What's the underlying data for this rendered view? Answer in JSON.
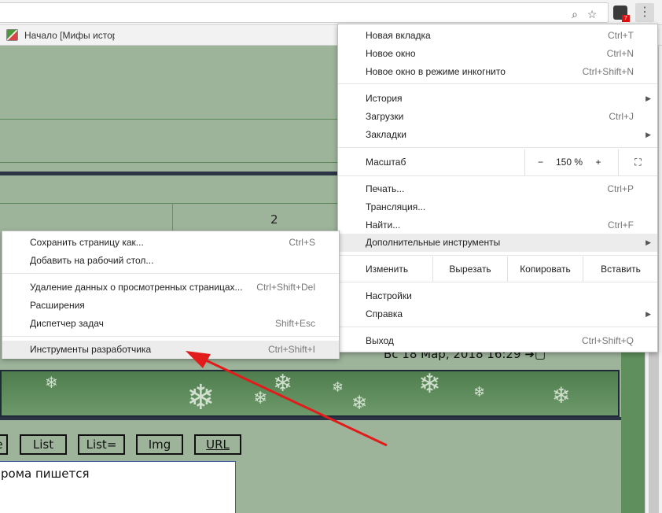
{
  "browser": {
    "bookmark_label": "Начало [Мифы истор",
    "icons": [
      "zoom-icon",
      "star-icon",
      "extension-icon",
      "menu-dots-icon"
    ],
    "extension_badge": "7"
  },
  "page": {
    "pagination_number": "2",
    "date_text": "Вс 18 Мар, 2018 16:29",
    "tag_buttons": [
      "e",
      "List",
      "List=",
      "Img",
      "URL"
    ],
    "textarea_value": "рома пишется"
  },
  "chrome_menu": {
    "new_tab": {
      "label": "Новая вкладка",
      "shortcut": "Ctrl+T"
    },
    "new_window": {
      "label": "Новое окно",
      "shortcut": "Ctrl+N"
    },
    "incognito": {
      "label": "Новое окно в режиме инкогнито",
      "shortcut": "Ctrl+Shift+N"
    },
    "history": {
      "label": "История"
    },
    "downloads": {
      "label": "Загрузки",
      "shortcut": "Ctrl+J"
    },
    "bookmarks": {
      "label": "Закладки"
    },
    "zoom": {
      "label": "Масштаб",
      "minus": "−",
      "value": "150 %",
      "plus": "+"
    },
    "print": {
      "label": "Печать...",
      "shortcut": "Ctrl+P"
    },
    "cast": {
      "label": "Трансляция..."
    },
    "find": {
      "label": "Найти...",
      "shortcut": "Ctrl+F"
    },
    "more_tools": {
      "label": "Дополнительные инструменты"
    },
    "edit": {
      "label": "Изменить",
      "cut": "Вырезать",
      "copy": "Копировать",
      "paste": "Вставить"
    },
    "settings": {
      "label": "Настройки"
    },
    "help": {
      "label": "Справка"
    },
    "exit": {
      "label": "Выход",
      "shortcut": "Ctrl+Shift+Q"
    }
  },
  "submenu": {
    "save_page": {
      "label": "Сохранить страницу как...",
      "shortcut": "Ctrl+S"
    },
    "add_desktop": {
      "label": "Добавить на рабочий стол..."
    },
    "clear_data": {
      "label": "Удаление данных о просмотренных страницах...",
      "shortcut": "Ctrl+Shift+Del"
    },
    "extensions": {
      "label": "Расширения"
    },
    "task_manager": {
      "label": "Диспетчер задач",
      "shortcut": "Shift+Esc"
    },
    "dev_tools": {
      "label": "Инструменты разработчика",
      "shortcut": "Ctrl+Shift+I"
    }
  },
  "colors": {
    "annotation_arrow": "#e21b1b",
    "page_bg": "#9db49b"
  }
}
